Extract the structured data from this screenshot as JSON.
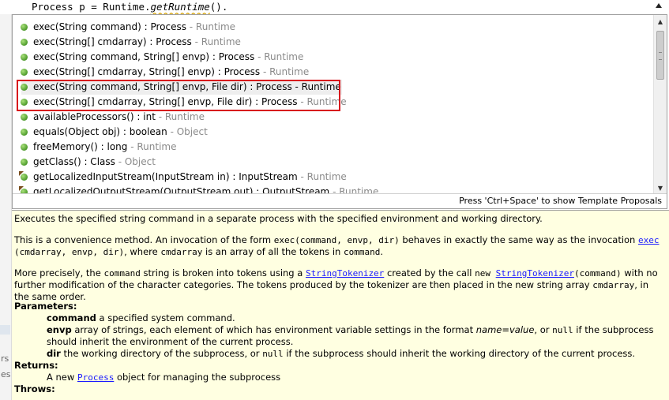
{
  "editor": {
    "code_prefix": "Process p = Runtime.",
    "code_method": "getRuntime",
    "code_suffix": "()."
  },
  "gutter": {
    "text_1": "rs",
    "text_2": "es"
  },
  "proposals": [
    {
      "sig": "exec(String command) : Process",
      "cls": " - Runtime",
      "icon": "public-method-icon"
    },
    {
      "sig": "exec(String[] cmdarray) : Process",
      "cls": " - Runtime",
      "icon": "public-method-icon"
    },
    {
      "sig": "exec(String command, String[] envp) : Process",
      "cls": " - Runtime",
      "icon": "public-method-icon"
    },
    {
      "sig": "exec(String[] cmdarray, String[] envp) : Process",
      "cls": " - Runtime",
      "icon": "public-method-icon"
    },
    {
      "sig": "exec(String command, String[] envp, File dir) : Process",
      "cls": " - Runtime",
      "icon": "public-method-icon",
      "selected": true
    },
    {
      "sig": "exec(String[] cmdarray, String[] envp, File dir) : Process",
      "cls": " - Runtime",
      "icon": "public-method-icon"
    },
    {
      "sig": "availableProcessors() : int",
      "cls": " - Runtime",
      "icon": "public-method-icon"
    },
    {
      "sig": "equals(Object obj) : boolean",
      "cls": " - Object",
      "icon": "public-method-icon"
    },
    {
      "sig": "freeMemory() : long",
      "cls": " - Runtime",
      "icon": "public-method-icon"
    },
    {
      "sig": "getClass() : Class",
      "cls": " - Object",
      "icon": "public-method-icon"
    },
    {
      "sig": "getLocalizedInputStream(InputStream in) : InputStream",
      "cls": " - Runtime",
      "icon": "deprecated-method-icon"
    },
    {
      "sig": "getLocalizedOutputStream(OutputStream out) : OutputStream",
      "cls": " - Runtime",
      "icon": "deprecated-method-icon"
    }
  ],
  "status": {
    "hint": "Press 'Ctrl+Space' to show Template Proposals"
  },
  "doc": {
    "summary": "Executes the specified string command in a separate process with the specified environment and working directory.",
    "p2_a": "This is a convenience method. An invocation of the form ",
    "p2_code1": "exec(command, envp, dir)",
    "p2_b": " behaves in exactly the same way as the invocation ",
    "p2_link": "exec",
    "p2_code2": "(cmdarray, envp, dir)",
    "p2_c": ", where ",
    "p2_code3": "cmdarray",
    "p2_d": " is an array of all the tokens in ",
    "p2_code4": "command",
    "p2_e": ".",
    "p3_a": "More precisely, the ",
    "p3_code1": "command",
    "p3_b": " string is broken into tokens using a ",
    "p3_link1": "StringTokenizer",
    "p3_c": " created by the call ",
    "p3_code2": "new ",
    "p3_link2": "StringTokenizer",
    "p3_code3": "(command)",
    "p3_d": " with no further modification of the character categories. The tokens produced by the tokenizer are then placed in the new string array ",
    "p3_code4": "cmdarray",
    "p3_e": ", in the same order.",
    "parameters_heading": "Parameters:",
    "param1_name": "command",
    "param1_desc": " a specified system command.",
    "param2_name": "envp",
    "param2_desc_a": " array of strings, each element of which has environment variable settings in the format ",
    "param2_desc_i": "name=value",
    "param2_desc_b": ", or ",
    "param2_desc_code": "null",
    "param2_desc_c": " if the subprocess should inherit the environment of the current process.",
    "param3_name": "dir",
    "param3_desc_a": " the working directory of the subprocess, or ",
    "param3_desc_code": "null",
    "param3_desc_b": " if the subprocess should inherit the working directory of the current process.",
    "returns_heading": "Returns:",
    "returns_a": "A new ",
    "returns_link": "Process",
    "returns_b": " object for managing the subprocess",
    "throws_heading": "Throws:"
  }
}
